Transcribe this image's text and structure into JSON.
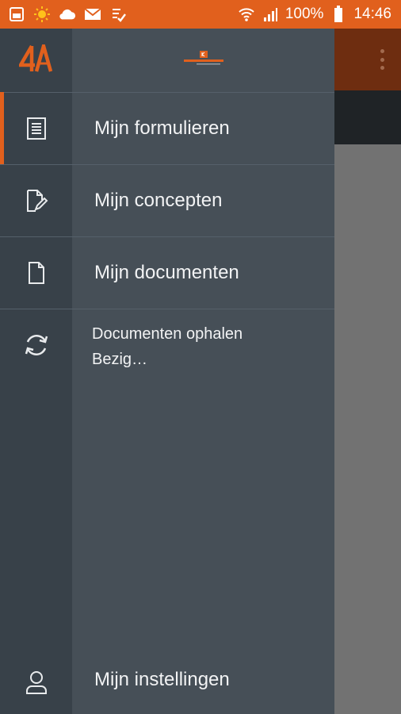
{
  "status_bar": {
    "left_icons": [
      "gallery-icon",
      "sun-icon",
      "cloud-icon",
      "mail-icon",
      "task-icon"
    ],
    "right_icons": [
      "wifi-icon",
      "signal-icon",
      "battery-icon"
    ],
    "battery": "100%",
    "time": "14:46"
  },
  "drawer": {
    "logo_icon": "4a-logo-icon",
    "brand_logo_icon": "brand-logo-icon",
    "items": [
      {
        "label": "Mijn formulieren",
        "icon": "form-list-icon",
        "active": true
      },
      {
        "label": "Mijn concepten",
        "icon": "edit-document-icon",
        "active": false
      },
      {
        "label": "Mijn documenten",
        "icon": "document-icon",
        "active": false
      }
    ],
    "sync": {
      "title": "Documenten ophalen",
      "status": "Bezig…",
      "icon": "sync-icon"
    },
    "settings": {
      "label": "Mijn instellingen",
      "icon": "user-icon"
    }
  },
  "colors": {
    "accent": "#e1601d",
    "rail": "#384149",
    "panel": "#464f57"
  }
}
